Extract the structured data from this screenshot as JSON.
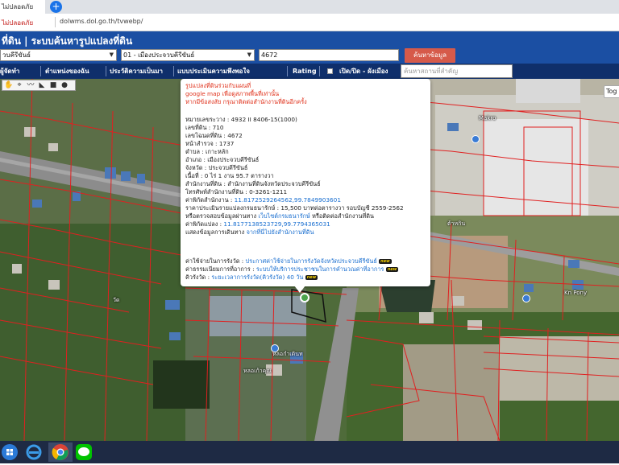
{
  "browser": {
    "tab_title": "ไม่ปลอดภัย",
    "new_tab": "+",
    "security": "ไม่ปลอดภัย",
    "url": "dolwms.dol.go.th/tvwebp/"
  },
  "site": {
    "title": "ที่ดิน | ระบบค้นหารูปแปลงที่ดิน",
    "province": "วบคีรีขันธ์",
    "district": "01 - เมืองประจวบคีรีขันธ์",
    "parcel_value": "4672",
    "search_button": "ค้นหาข้อมูล"
  },
  "menu": {
    "items": [
      "ผู้จัดทำ",
      "ตำแหน่งของฉัน",
      "ประวัติความเป็นมา",
      "แบบประเมินความพึงพอใจ",
      "Rating",
      "เปิด/ปิด - ผังเมือง"
    ],
    "place_placeholder": "ค้นหาสถานที่สำคัญ"
  },
  "map": {
    "toggle_label": "Tog",
    "labels": [
      "Makro",
      "Kn Pony",
      "ต้าหกิน",
      "วัด",
      "หลอกำเดินท",
      "หลอเก้าคุณ"
    ]
  },
  "popup": {
    "warn1": "รูปแปลงที่ดินร่วมกับแผนที่",
    "warn2": "google map เพื่อดูสภาพพื้นที่เท่านั้น",
    "warn3": "หากมีข้อสงสัย กรุณาติดต่อสำนักงานที่ดินอีกครั้ง",
    "l1": "หมายเลขระวาง : 4932 II 8406-15(1000)",
    "l2": "เลขที่ดิน : 710",
    "l3": "เลขโฉนดที่ดิน : 4672",
    "l4": "หน้าสำรวจ : 1737",
    "l5": "ตำบล : เกาะหลัก",
    "l6": "อำเภอ : เมืองประจวบคีรีขันธ์",
    "l7": "จังหวัด : ประจวบคีรีขันธ์",
    "l8": "เนื้อที่ : 0 ไร่ 1 งาน 95.7 ตารางวา",
    "l9": "สำนักงานที่ดิน : สำนักงานที่ดินจังหวัดประจวบคีรีขันธ์",
    "l10": "โทรศัพท์สำนักงานที่ดิน : 0-3261-1211",
    "l11_label": "ค่าพิกัดสำนักงาน : ",
    "l11_value": "11.8172529264562,99.7849903601",
    "l12": "ราคาประเมินรายแปลงกรมธนารักษ์ : 15,500 บาทต่อตารางวา รอบบัญชี 2559-2562",
    "l13_a": "หรือตรวจสอบข้อมูลผ่านทาง ",
    "l13_link": "เว็บไซต์กรมธนารักษ์",
    "l13_b": " หรือติดต่อสำนักงานที่ดิน",
    "l14_label": "ค่าพิกัดแปลง : ",
    "l14_value": "11.8177138523729,99.7794365031",
    "l15_a": "แสดงข้อมูลการเดินทาง ",
    "l15_link": "จากที่นี่ไปยังสำนักงานที่ดิน",
    "l16_a": "ค่าใช้จ่ายในการรังวัด : ",
    "l16_link": "ประกาศค่าใช้จ่ายในการรังวัดจังหวัดประจวบคีรีขันธ์",
    "l17_a": "ค่าธรรมเนียมการที่อาการ : ",
    "l17_link": "ระบบให้บริการประชาชนในการคำนวณค่าที่อาการ",
    "l18_a": "คิวรังวัด : ",
    "l18_link": "ระยะเวลาการรังวัด(คิวรังวัด) 40 วัน",
    "new_badge": "new"
  },
  "colors": {
    "header": "#1b4fa3",
    "menubar": "#0f2f6b",
    "search_button": "#d65a4a",
    "warning_text": "#e0321c",
    "link_text": "#1a6fd0",
    "parcel_lines": "#e02020"
  }
}
